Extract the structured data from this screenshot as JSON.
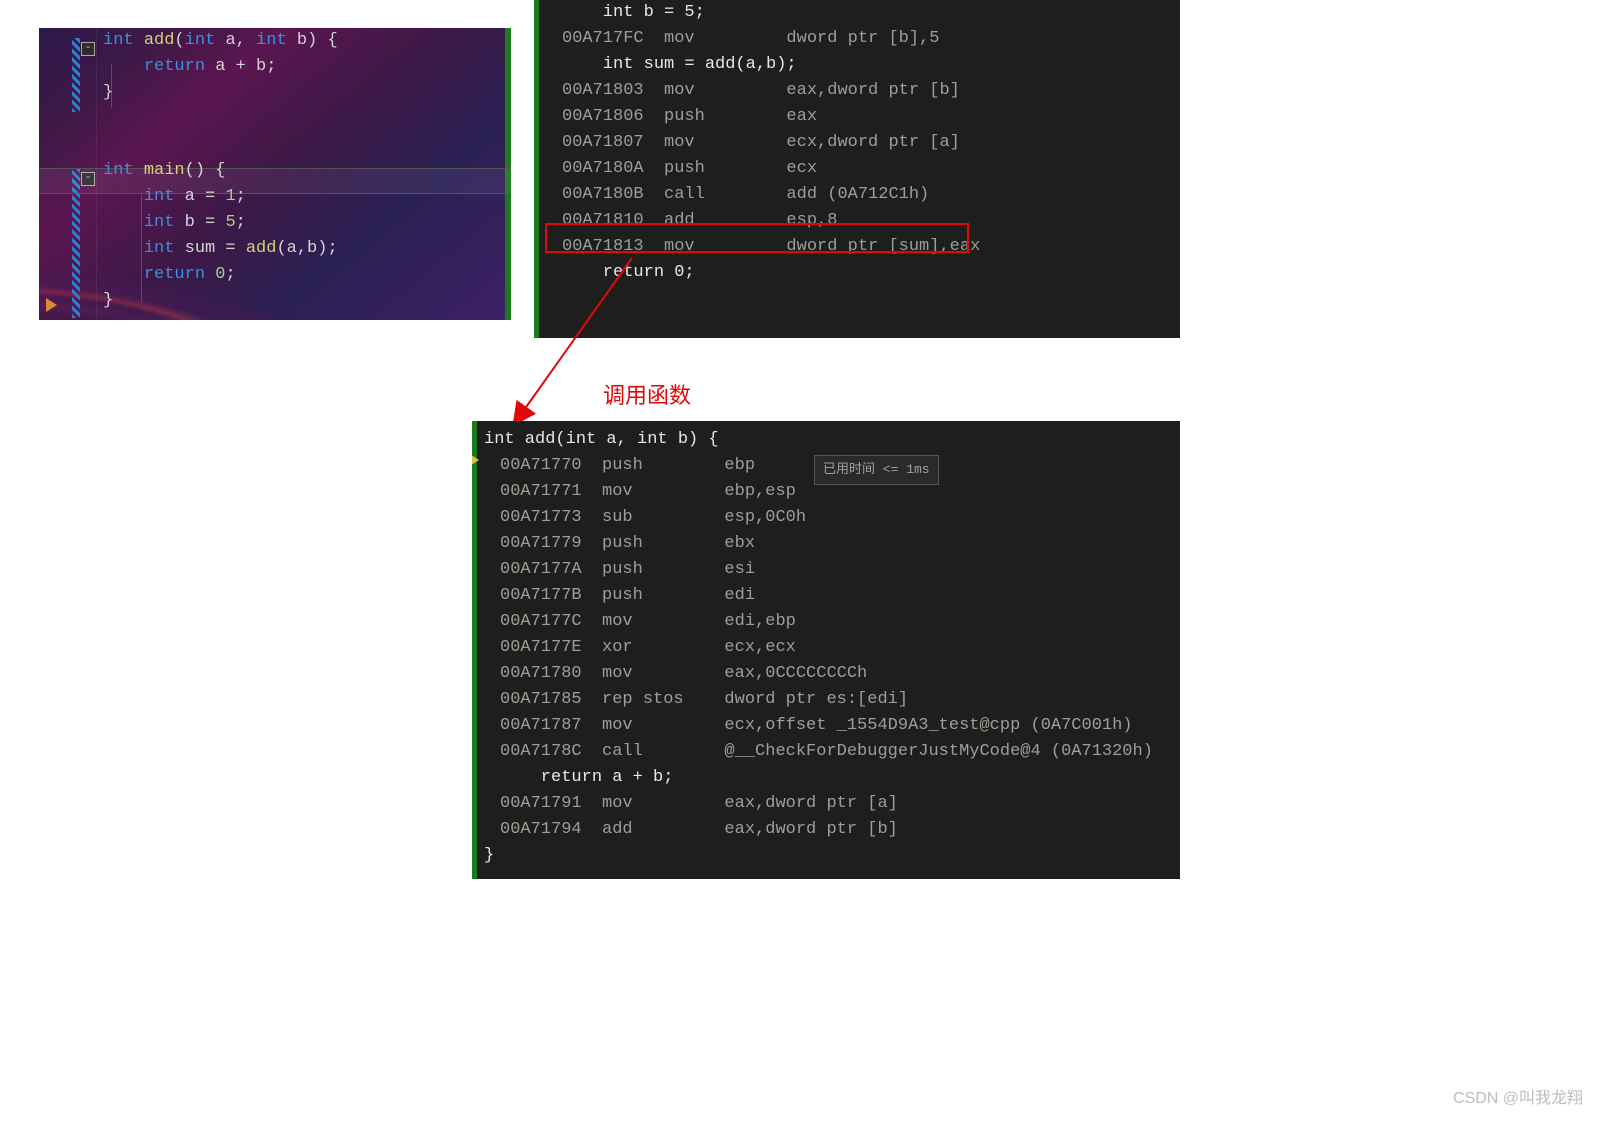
{
  "source": {
    "add_signature": {
      "kw1": "int",
      "name": "add",
      "p1t": "int",
      "p1": "a",
      "p2t": "int",
      "p2": "b",
      "brace": "{"
    },
    "add_body": {
      "kw": "return",
      "expr": " a + b;"
    },
    "close1": "}",
    "main_sig": {
      "kw1": "int",
      "name": "main",
      "paren": "()",
      "brace": " {"
    },
    "main_l1": {
      "kw": "int",
      "rest": " a = ",
      "val": "1",
      "semi": ";"
    },
    "main_l2": {
      "kw": "int",
      "rest": " b = ",
      "val": "5",
      "semi": ";"
    },
    "main_l3": {
      "kw": "int",
      "rest": " sum = ",
      "fn": "add",
      "call": "(a,b);"
    },
    "main_l4": {
      "kw": "return",
      "rest": " ",
      "val": "0",
      "semi": ";"
    },
    "close2": "}"
  },
  "asm_main": [
    {
      "t": "src",
      "txt": "    int b = 5;"
    },
    {
      "addr": "00A717FC",
      "op": "mov",
      "arg": "dword ptr [b],5"
    },
    {
      "t": "src",
      "txt": "    int sum = add(a,b);"
    },
    {
      "addr": "00A71803",
      "op": "mov",
      "arg": "eax,dword ptr [b]"
    },
    {
      "addr": "00A71806",
      "op": "push",
      "arg": "eax"
    },
    {
      "addr": "00A71807",
      "op": "mov",
      "arg": "ecx,dword ptr [a]"
    },
    {
      "addr": "00A7180A",
      "op": "push",
      "arg": "ecx"
    },
    {
      "addr": "00A7180B",
      "op": "call",
      "arg": "add (0A712C1h)"
    },
    {
      "addr": "00A71810",
      "op": "add",
      "arg": "esp,8"
    },
    {
      "addr": "00A71813",
      "op": "mov",
      "arg": "dword ptr [sum],eax"
    },
    {
      "t": "src",
      "txt": "    return 0;"
    }
  ],
  "asm_add_header": "int add(int a, int b) {",
  "asm_add": [
    {
      "addr": "00A71770",
      "op": "push",
      "arg": "ebp"
    },
    {
      "addr": "00A71771",
      "op": "mov",
      "arg": "ebp,esp"
    },
    {
      "addr": "00A71773",
      "op": "sub",
      "arg": "esp,0C0h"
    },
    {
      "addr": "00A71779",
      "op": "push",
      "arg": "ebx"
    },
    {
      "addr": "00A7177A",
      "op": "push",
      "arg": "esi"
    },
    {
      "addr": "00A7177B",
      "op": "push",
      "arg": "edi"
    },
    {
      "addr": "00A7177C",
      "op": "mov",
      "arg": "edi,ebp"
    },
    {
      "addr": "00A7177E",
      "op": "xor",
      "arg": "ecx,ecx"
    },
    {
      "addr": "00A71780",
      "op": "mov",
      "arg": "eax,0CCCCCCCCh"
    },
    {
      "addr": "00A71785",
      "op": "rep stos",
      "arg": "dword ptr es:[edi]"
    },
    {
      "addr": "00A71787",
      "op": "mov",
      "arg": "ecx,offset _1554D9A3_test@cpp (0A7C001h)"
    },
    {
      "addr": "00A7178C",
      "op": "call",
      "arg": "@__CheckForDebuggerJustMyCode@4 (0A71320h)"
    }
  ],
  "asm_add_src": "    return a + b;",
  "asm_add_tail": [
    {
      "addr": "00A71791",
      "op": "mov",
      "arg": "eax,dword ptr [a]"
    },
    {
      "addr": "00A71794",
      "op": "add",
      "arg": "eax,dword ptr [b]"
    }
  ],
  "asm_add_close": "}",
  "perf": "已用时间 <= 1ms",
  "anno": "调用函数",
  "watermark": "CSDN @叫我龙翔"
}
